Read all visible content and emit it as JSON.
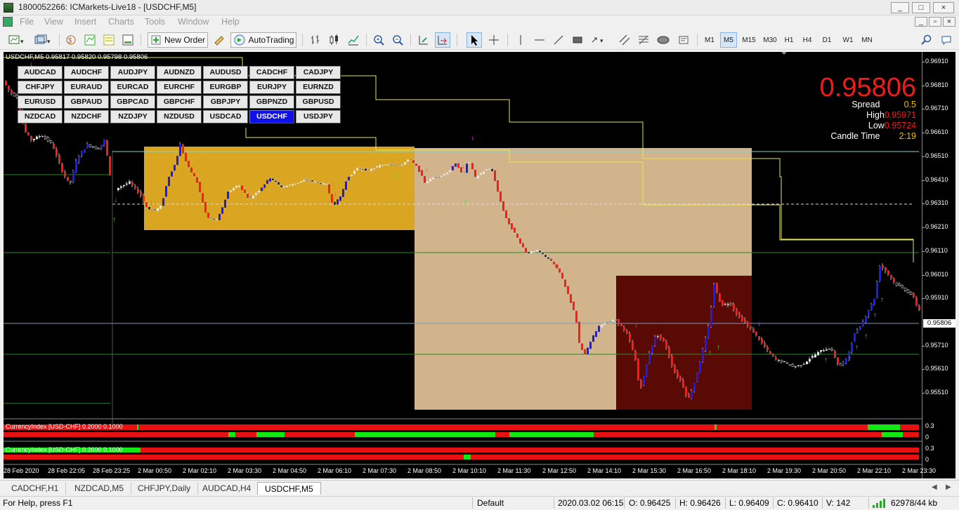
{
  "window": {
    "title": "1800052266: ICMarkets-Live18 - [USDCHF,M5]",
    "controls": [
      "_",
      "□",
      "×"
    ],
    "inner_controls": [
      "_",
      "▫",
      "×"
    ]
  },
  "menu": [
    "File",
    "View",
    "Insert",
    "Charts",
    "Tools",
    "Window",
    "Help"
  ],
  "toolbar": {
    "new_order_label": "New Order",
    "autotrading_label": "AutoTrading",
    "timeframes": [
      "M1",
      "M5",
      "M15",
      "M30",
      "H1",
      "H4",
      "D1",
      "W1",
      "MN"
    ],
    "selected_timeframe": "M5"
  },
  "chart": {
    "header": "USDCHF,M5  0.95817 0.95820 0.95798 0.95806",
    "price": "0.95806",
    "spread_label": "Spread",
    "spread_value": "0.5",
    "high_label": "High",
    "high_value": "0.95971",
    "low_label": "Low",
    "low_value": "0.95724",
    "candle_time_label": "Candle Time",
    "candle_time_value": "2:19",
    "current_price_tag": "0.95806",
    "y_ticks": [
      "0.96910",
      "0.96810",
      "0.96710",
      "0.96610",
      "0.96510",
      "0.96410",
      "0.96310",
      "0.96210",
      "0.96110",
      "0.96010",
      "0.95910",
      "0.95710",
      "0.95610",
      "0.95510"
    ],
    "x_ticks": [
      "28 Feb 2020",
      "28 Feb 22:05",
      "28 Feb 23:25",
      "2 Mar 00:50",
      "2 Mar 02:10",
      "2 Mar 03:30",
      "2 Mar 04:50",
      "2 Mar 06:10",
      "2 Mar 07:30",
      "2 Mar 08:50",
      "2 Mar 10:10",
      "2 Mar 11:30",
      "2 Mar 12:50",
      "2 Mar 14:10",
      "2 Mar 15:30",
      "2 Mar 16:50",
      "2 Mar 18:10",
      "2 Mar 19:30",
      "2 Mar 20:50",
      "2 Mar 22:10",
      "2 Mar 23:30"
    ],
    "sub1_label": "CurrencyIndex [USD-CHF] 0.2000 0.1000",
    "sub1_ticks": [
      "0.3",
      "0"
    ],
    "sub2_label": "CurrencyIndex [USD-CHF] 0.2000 0.1000",
    "sub2_ticks": [
      "0.3",
      "0"
    ],
    "colors": {
      "bull": "#1a1aff",
      "bear": "#ff1a1a",
      "range_gold": "#daa520",
      "range_tan": "#d2b48c",
      "range_dark": "#5a0a05",
      "yellow_line": "#e8e84a"
    }
  },
  "pair_buttons": [
    [
      "AUDCAD",
      "AUDCHF",
      "AUDJPY",
      "AUDNZD",
      "AUDUSD",
      "CADCHF",
      "CADJPY"
    ],
    [
      "CHFJPY",
      "EURAUD",
      "EURCAD",
      "EURCHF",
      "EURGBP",
      "EURJPY",
      "EURNZD"
    ],
    [
      "EURUSD",
      "GBPAUD",
      "GBPCAD",
      "GBPCHF",
      "GBPJPY",
      "GBPNZD",
      "GBPUSD"
    ],
    [
      "NZDCAD",
      "NZDCHF",
      "NZDJPY",
      "NZDUSD",
      "USDCAD",
      "USDCHF",
      "USDJPY"
    ]
  ],
  "active_pair": "USDCHF",
  "tabs": [
    "CADCHF,H1",
    "NZDCAD,M5",
    "CHFJPY,Daily",
    "AUDCAD,H4",
    "USDCHF,M5"
  ],
  "active_tab": "USDCHF,M5",
  "status": {
    "help": "For Help, press F1",
    "profile": "Default",
    "datetime": "2020.03.02 06:15",
    "open": "O: 0.96425",
    "high": "H: 0.96426",
    "low": "L: 0.96409",
    "close": "C: 0.96410",
    "volume": "V: 142",
    "traffic": "62978/44 kb"
  }
}
